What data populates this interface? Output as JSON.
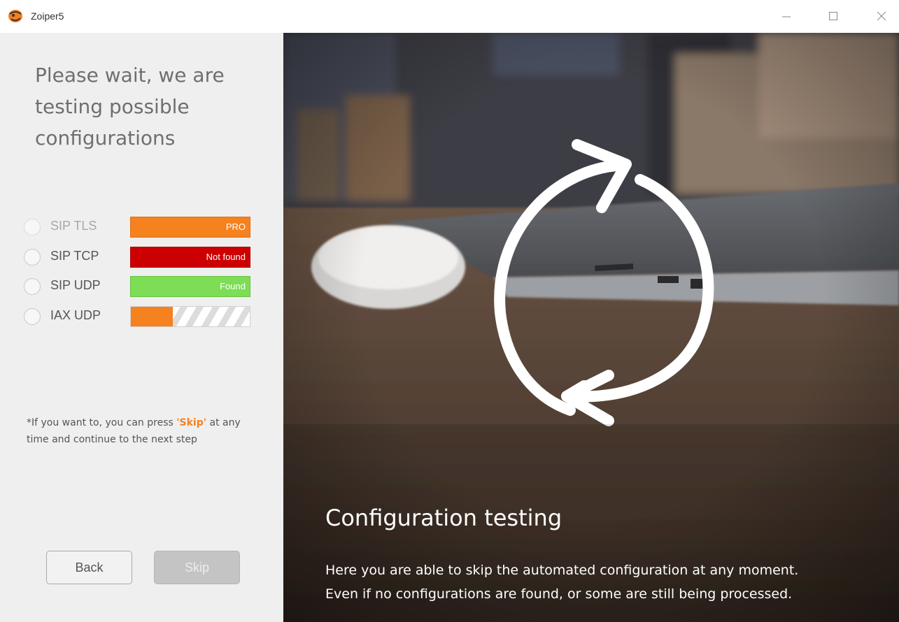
{
  "window": {
    "title": "Zoiper5",
    "controls": {
      "minimize": "minimize-icon",
      "maximize": "maximize-icon",
      "close": "close-icon"
    }
  },
  "left": {
    "heading": "Please wait, we are\ntesting possible\nconfigurations",
    "protocols": [
      {
        "label": "SIP TLS",
        "status": "PRO",
        "status_type": "pro",
        "color": "#f5811f"
      },
      {
        "label": "SIP TCP",
        "status": "Not found",
        "status_type": "not-found",
        "color": "#cc0000"
      },
      {
        "label": "SIP UDP",
        "status": "Found",
        "status_type": "found",
        "color": "#7ddd55"
      },
      {
        "label": "IAX UDP",
        "status": "",
        "status_type": "in-progress",
        "progress": 0.35,
        "color": "#f5811f"
      }
    ],
    "note_prefix": "*If you want to, you can press ",
    "note_skip": "'Skip'",
    "note_suffix": " at any time and continue to the next step",
    "buttons": {
      "back": "Back",
      "skip": "Skip"
    }
  },
  "hero": {
    "icon": "refresh-cycle-icon",
    "title": "Configuration testing",
    "description": " Here you are able to skip the automated configuration at any moment. Even if no configurations are found, or some are still being processed."
  },
  "colors": {
    "accent": "#f5811f",
    "error": "#cc0000",
    "success": "#7ddd55"
  }
}
